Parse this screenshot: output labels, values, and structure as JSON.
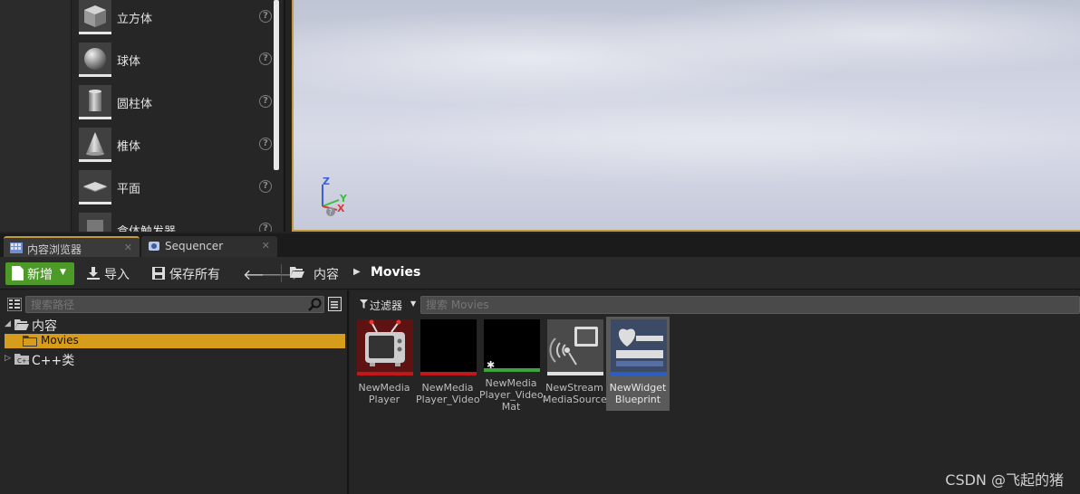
{
  "place_panel": {
    "items": [
      {
        "label": "立方体",
        "icon": "cube-icon"
      },
      {
        "label": "球体",
        "icon": "sphere-icon"
      },
      {
        "label": "圆柱体",
        "icon": "cylinder-icon"
      },
      {
        "label": "椎体",
        "icon": "cone-icon"
      },
      {
        "label": "平面",
        "icon": "plane-icon"
      },
      {
        "label": "盒体触发器",
        "icon": "box-trigger-icon"
      }
    ],
    "help_glyph": "?"
  },
  "viewport": {
    "axes": {
      "z": "Z",
      "y": "Y",
      "x": "X"
    }
  },
  "tabs": [
    {
      "label": "内容浏览器",
      "icon": "content-browser-icon",
      "active": true,
      "close": "✕"
    },
    {
      "label": "Sequencer",
      "icon": "sequencer-icon",
      "active": false,
      "close": "✕"
    }
  ],
  "toolbar": {
    "new_label": "新增",
    "import_label": "导入",
    "save_all_label": "保存所有",
    "breadcrumb_root": "内容",
    "breadcrumb_current": "Movies"
  },
  "tree": {
    "search_placeholder": "搜索路径",
    "items": [
      {
        "label": "内容",
        "expanded": true
      },
      {
        "label": "Movies",
        "selected": true
      },
      {
        "label": "C++类",
        "expanded": false
      }
    ]
  },
  "assets": {
    "filter_label": "过滤器",
    "search_placeholder": "搜索 Movies",
    "tiles": [
      {
        "name": "NewMedia\nPlayer",
        "icon": "tv-icon",
        "bar_color": "#c01818"
      },
      {
        "name": "NewMedia\nPlayer_Video",
        "icon": "black-thumbnail",
        "bar_color": "#c01818"
      },
      {
        "name": "NewMedia\nPlayer_Video_\nMat",
        "icon": "material-thumbnail",
        "bar_color": "#3aa63a"
      },
      {
        "name": "NewStream\nMediaSource",
        "icon": "stream-source-icon",
        "bar_color": "#e0e0e0"
      },
      {
        "name": "NewWidget\nBlueprint",
        "icon": "widget-blueprint-icon",
        "bar_color": "#2c5ec2",
        "selected": true
      }
    ]
  },
  "watermark": "CSDN @飞起的猪"
}
